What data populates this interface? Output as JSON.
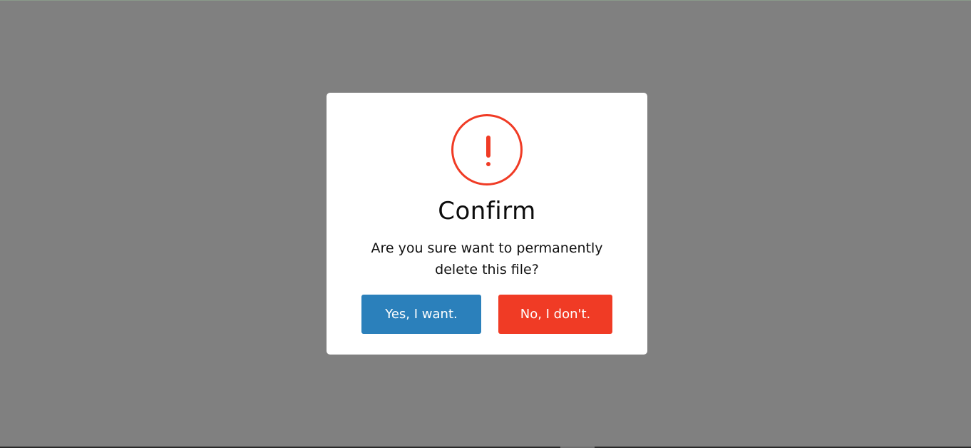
{
  "dialog": {
    "icon": "exclamation-circle-icon",
    "title": "Confirm",
    "message": "Are you sure want to permanently delete this file?",
    "confirm_label": "Yes, I want.",
    "cancel_label": "No, I don't."
  },
  "colors": {
    "overlay": "#808080",
    "dialog_background": "#ffffff",
    "alert_accent": "#f03b25",
    "confirm_button": "#2b80bb",
    "cancel_button": "#f03b25"
  }
}
